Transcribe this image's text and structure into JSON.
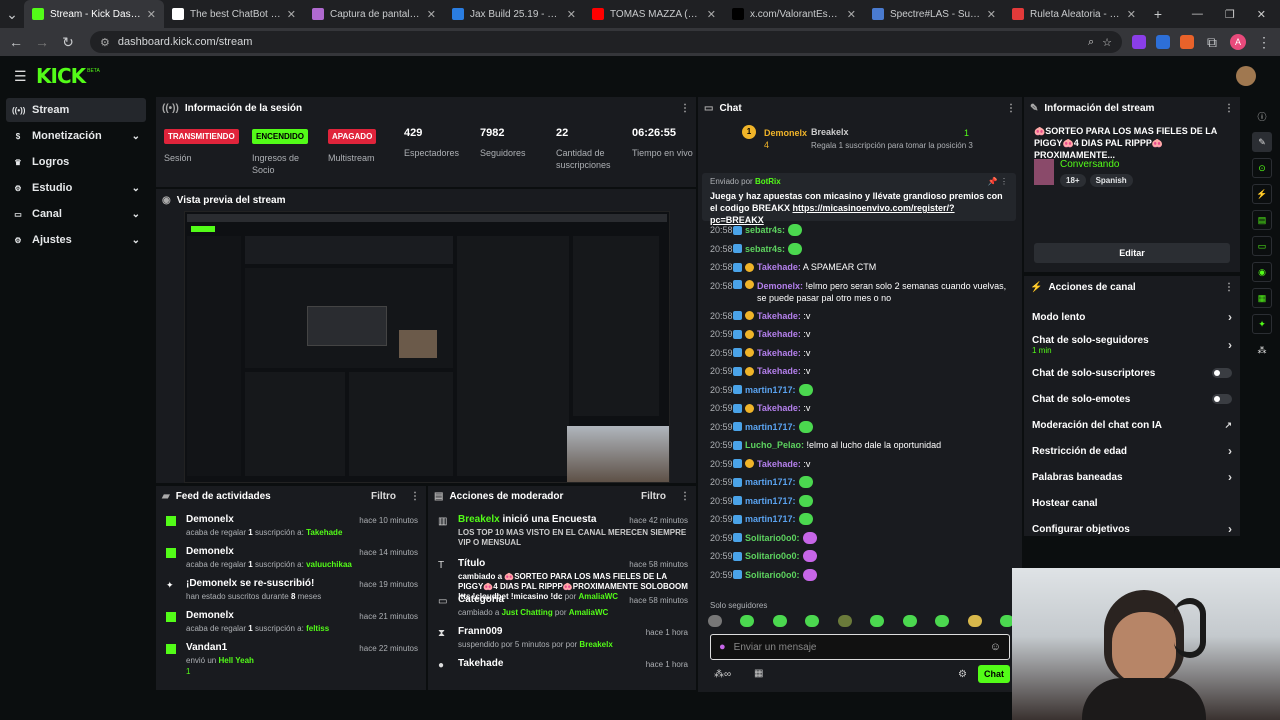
{
  "browser": {
    "tabs": [
      {
        "title": "Stream - Kick Dashboard",
        "color": "#53fc18",
        "active": true
      },
      {
        "title": "The best ChatBot and Wi",
        "color": "#ffffff"
      },
      {
        "title": "Captura de pantalla por L",
        "color": "#b06ad0"
      },
      {
        "title": "Jax Build 25.19 - Runes, It",
        "color": "#2a7de1"
      },
      {
        "title": "TOMÁS MAZZA (Y ALONS",
        "color": "#ff0000"
      },
      {
        "title": "x.com/ValorantEsports/st",
        "color": "#000000"
      },
      {
        "title": "Spectre#LAS - Summone",
        "color": "#4a7bd0"
      },
      {
        "title": "Ruleta Aleatoria - Selecto",
        "color": "#e33a3a"
      }
    ],
    "url": "dashboard.kick.com/stream",
    "profile_initial": "A"
  },
  "header": {
    "logo": "KICK",
    "logo_beta": "BETA"
  },
  "sidebar": {
    "items": [
      {
        "label": "Stream",
        "icon": "stream-icon",
        "active": true
      },
      {
        "label": "Monetización",
        "icon": "dollar-icon",
        "chevron": true
      },
      {
        "label": "Logros",
        "icon": "trophy-icon"
      },
      {
        "label": "Estudio",
        "icon": "studio-icon",
        "chevron": true
      },
      {
        "label": "Canal",
        "icon": "channel-icon",
        "chevron": true
      },
      {
        "label": "Ajustes",
        "icon": "gear-icon",
        "chevron": true
      }
    ]
  },
  "session": {
    "title": "Información de la sesión",
    "badges": [
      {
        "label": "TRANSMITIENDO",
        "sub": "Sesión",
        "bg": "#e0243b",
        "fg": "#ffffff"
      },
      {
        "label": "ENCENDIDO",
        "sub": "Ingresos de Socio",
        "bg": "#53fc18",
        "fg": "#000000"
      },
      {
        "label": "APAGADO",
        "sub": "Multistream",
        "bg": "#e0243b",
        "fg": "#ffffff"
      }
    ],
    "stats": [
      {
        "value": "429",
        "label": "Espectadores"
      },
      {
        "value": "7982",
        "label": "Seguidores"
      },
      {
        "value": "22",
        "label": "Cantidad de suscripciones"
      },
      {
        "value": "06:26:55",
        "label": "Tiempo en vivo"
      }
    ]
  },
  "preview": {
    "title": "Vista previa del stream"
  },
  "activity": {
    "title": "Feed de actividades",
    "filter": "Filtro",
    "items": [
      {
        "name": "Demonelx",
        "pre": "acaba de regalar ",
        "num": "1",
        "mid": " suscripción a: ",
        "target": "Takehade",
        "time": "hace 10 minutos"
      },
      {
        "name": "Demonelx",
        "pre": "acaba de regalar ",
        "num": "1",
        "mid": " suscripción a: ",
        "target": "valuuchikaa",
        "time": "hace 14 minutos"
      },
      {
        "name": "¡Demonelx se re-suscribió!",
        "pre": "han estado suscritos durante ",
        "num": "8",
        "mid": " meses",
        "target": "",
        "time": "hace 19 minutos"
      },
      {
        "name": "Demonelx",
        "pre": "acaba de regalar ",
        "num": "1",
        "mid": " suscripción a: ",
        "target": "feltiss",
        "time": "hace 21 minutos"
      },
      {
        "name": "Vandan1",
        "pre": "envió un ",
        "num": "",
        "mid": "",
        "target": "Hell Yeah",
        "time": "hace 22 minutos",
        "extra": "1"
      }
    ]
  },
  "modactions": {
    "title": "Acciones de moderador",
    "filter": "Filtro",
    "items": [
      {
        "name": "Breakelx",
        "head_rest": " inició una Encuesta",
        "desc": "LOS TOP 10 MAS VISTO EN EL CANAL MERECEN SIEMPRE VIP O MENSUAL",
        "time": "hace 42 minutos"
      },
      {
        "name": "Título",
        "head_rest": "",
        "desc": "cambiado a 🐽SORTEO PARA LOS MAS FIELES DE LA PIGGY🐽4 DIAS PAL RIPPP🐽PROXIMAMENTE SOLOBOOM !tts !cloudbet !micasino !dc",
        "by": "AmaliaWC",
        "time": "hace 58 minutos"
      },
      {
        "name": "Categoría",
        "head_rest": "",
        "desc": "cambiado a ",
        "cat": "Just Chatting",
        "by": "AmaliaWC",
        "time": "hace 58 minutos"
      },
      {
        "name": "Frann009",
        "head_rest": "",
        "desc": "suspendido por 5 minutos por ",
        "by": "Breakelx",
        "time": "hace 1 hora"
      },
      {
        "name": "Takehade",
        "head_rest": "",
        "desc": "",
        "time": "hace 1 hora"
      }
    ]
  },
  "chat": {
    "title": "Chat",
    "leader1": {
      "name": "Demonelx",
      "count": "4"
    },
    "leader2": {
      "name": "Breakelx",
      "count": "1",
      "sub": "Regala 1 suscripción para tomar la posición 3"
    },
    "pinned": {
      "by_label": "Enviado por",
      "by": "BotRix",
      "text": "Juega y haz apuestas con micasino y llévate grandioso premios con el codigo BREAKX ",
      "link": "https://micasinoenvivo.com/register/?pc=BREAKX"
    },
    "messages": [
      {
        "ts": "20:58",
        "user": "sebatr4s:",
        "color": "#5dd25f",
        "text": "",
        "emote": "g"
      },
      {
        "ts": "20:58",
        "user": "sebatr4s:",
        "color": "#5dd25f",
        "text": "",
        "emote": "g"
      },
      {
        "ts": "20:58",
        "user": "Takehade:",
        "color": "#b37feb",
        "text": " A SPAMEAR CTM",
        "emote": ""
      },
      {
        "ts": "20:58",
        "user": "Demonelx:",
        "color": "#b37feb",
        "text": " !elmo pero seran solo 2 semanas cuando vuelvas, se puede pasar pal otro mes o no",
        "emote": "",
        "tall": true
      },
      {
        "ts": "20:58",
        "user": "Takehade:",
        "color": "#b37feb",
        "text": " :v",
        "emote": ""
      },
      {
        "ts": "20:59",
        "user": "Takehade:",
        "color": "#b37feb",
        "text": " :v",
        "emote": ""
      },
      {
        "ts": "20:59",
        "user": "Takehade:",
        "color": "#b37feb",
        "text": " :v",
        "emote": ""
      },
      {
        "ts": "20:59",
        "user": "Takehade:",
        "color": "#b37feb",
        "text": " :v",
        "emote": ""
      },
      {
        "ts": "20:59",
        "user": "martin1717:",
        "color": "#5aa3f0",
        "text": "",
        "emote": "g"
      },
      {
        "ts": "20:59",
        "user": "Takehade:",
        "color": "#b37feb",
        "text": " :v",
        "emote": ""
      },
      {
        "ts": "20:59",
        "user": "martin1717:",
        "color": "#5aa3f0",
        "text": "",
        "emote": "g"
      },
      {
        "ts": "20:59",
        "user": "Lucho_Pelao:",
        "color": "#5dd25f",
        "text": " !elmo al lucho dale la oportunidad",
        "emote": ""
      },
      {
        "ts": "20:59",
        "user": "Takehade:",
        "color": "#b37feb",
        "text": " :v",
        "emote": ""
      },
      {
        "ts": "20:59",
        "user": "martin1717:",
        "color": "#5aa3f0",
        "text": "",
        "emote": "g"
      },
      {
        "ts": "20:59",
        "user": "martin1717:",
        "color": "#5aa3f0",
        "text": "",
        "emote": "g"
      },
      {
        "ts": "20:59",
        "user": "martin1717:",
        "color": "#5aa3f0",
        "text": "",
        "emote": "g"
      },
      {
        "ts": "20:59",
        "user": "Solitario0o0:",
        "color": "#5dd25f",
        "text": "",
        "emote": "p"
      },
      {
        "ts": "20:59",
        "user": "Solitario0o0:",
        "color": "#5dd25f",
        "text": "",
        "emote": "p"
      },
      {
        "ts": "20:59",
        "user": "Solitario0o0:",
        "color": "#5dd25f",
        "text": "",
        "emote": "p"
      }
    ],
    "followers_only": "Solo seguidores",
    "input_placeholder": "Enviar un mensaje",
    "send_label": "Chat"
  },
  "streaminfo": {
    "title": "Información del stream",
    "stream_title": "🐽SORTEO PARA LOS MAS FIELES DE LA PIGGY🐽4 DIAS PAL RIPPP🐽PROXIMAMENTE...",
    "category": "Conversando",
    "tags": [
      "18+",
      "Spanish"
    ],
    "edit_label": "Editar"
  },
  "channelactions": {
    "title": "Acciones de canal",
    "items": [
      {
        "label": "Modo lento",
        "type": "arrow"
      },
      {
        "label": "Chat de solo-seguidores",
        "sub": "1 min",
        "type": "arrow"
      },
      {
        "label": "Chat de solo-suscriptores",
        "type": "toggle"
      },
      {
        "label": "Chat de solo-emotes",
        "type": "toggle"
      },
      {
        "label": "Moderación del chat con IA",
        "type": "ext"
      },
      {
        "label": "Restricción de edad",
        "type": "arrow"
      },
      {
        "label": "Palabras baneadas",
        "type": "arrow"
      },
      {
        "label": "Hostear canal",
        "type": "none"
      },
      {
        "label": "Configurar objetivos",
        "type": "arrow"
      }
    ]
  },
  "colors": {
    "accent": "#53fc18",
    "panel": "#191b1f",
    "bg": "#0b0e0f",
    "live": "#e0243b"
  }
}
